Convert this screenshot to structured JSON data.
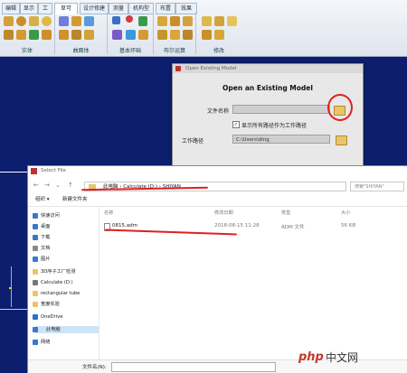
{
  "ribbon": {
    "tabs": [
      "编辑",
      "显示",
      "工",
      "草可",
      "设计修建",
      "测量",
      "机构型",
      "布置",
      "效果"
    ],
    "groups": [
      "实体",
      "曲面体",
      "基本环础",
      "布尔运算",
      "修改"
    ]
  },
  "open_dialog": {
    "window_title": "Open Existing Model",
    "heading": "Open an Existing Model",
    "file_label": "文件名称",
    "checkbox_label": "显示所有路径作为工作路径",
    "workdir_label": "工作路径",
    "workdir_value": "C:\\Users\\ding"
  },
  "explorer": {
    "window_title": "Select File",
    "breadcrumb": [
      "此电脑",
      "Calculate (D:)",
      "SHIYAN"
    ],
    "search_placeholder": "搜索\"SHIYAN\"",
    "toolbar": {
      "organize": "组织 ▾",
      "new_folder": "新建文件夹"
    },
    "columns": {
      "name": "名称",
      "date": "修改日期",
      "type": "类型",
      "size": "大小"
    },
    "sidebar": [
      {
        "label": "快速访问",
        "icon": "star-icon",
        "color": "#3a78c9"
      },
      {
        "label": "桌面",
        "icon": "desktop-icon",
        "color": "#3a78c9"
      },
      {
        "label": "下载",
        "icon": "download-icon",
        "color": "#3a78c9"
      },
      {
        "label": "文档",
        "icon": "document-icon",
        "color": "#8a8a8a"
      },
      {
        "label": "图片",
        "icon": "picture-icon",
        "color": "#3a78c9"
      },
      {
        "label": "3D序子工厂检测",
        "icon": "folder-icon",
        "color": "#e9c56a"
      },
      {
        "label": "Calculate (D:)",
        "icon": "drive-icon",
        "color": "#777"
      },
      {
        "label": "rectangular tube",
        "icon": "folder-icon",
        "color": "#e9c56a"
      },
      {
        "label": "宽度实验",
        "icon": "folder-icon",
        "color": "#e9c56a"
      },
      {
        "label": "OneDrive",
        "icon": "cloud-icon",
        "color": "#2a6fd0"
      },
      {
        "label": "此电脑",
        "icon": "computer-icon",
        "color": "#3a78c9"
      },
      {
        "label": "网络",
        "icon": "network-icon",
        "color": "#3a78c9"
      }
    ],
    "files": [
      {
        "name": "0815.adm",
        "date": "2018-08-15 11:28",
        "type": "ADM 文件",
        "size": "56 KB"
      }
    ],
    "filename_label": "文件名(N):"
  },
  "colors": {
    "viewport": "#0d1e6e",
    "annotation": "#e02020"
  }
}
